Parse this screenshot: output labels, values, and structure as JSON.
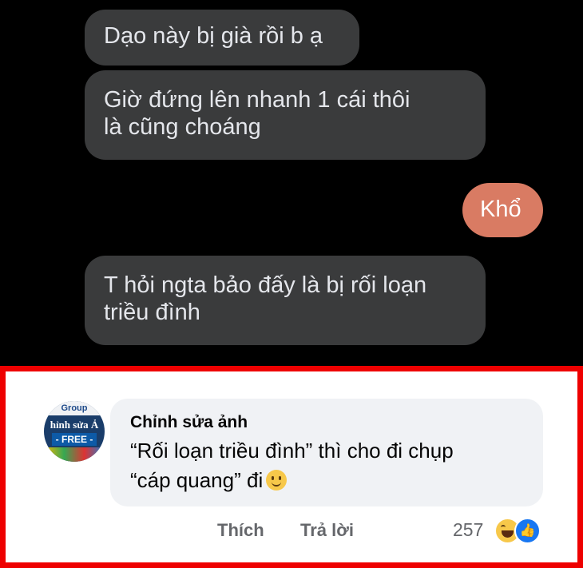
{
  "messages": [
    {
      "text": "Dạo này bị già rồi b ạ",
      "side": "received"
    },
    {
      "line1": "Giờ đứng lên nhanh 1 cái thôi",
      "line2": "là cũng choáng",
      "side": "received"
    },
    {
      "text": "Khổ",
      "side": "sent"
    },
    {
      "line1": "T hỏi ngta bảo đấy là bị rối loạn",
      "line2": "triều đình",
      "side": "received"
    }
  ],
  "comment": {
    "author": "Chỉnh sửa ảnh",
    "line1": "“Rối loạn triều đình” thì cho đi chụp",
    "line2": "“cáp quang” đi",
    "avatar": {
      "group": "Group",
      "name": "hỉnh sửa Ả",
      "free": "- FREE -"
    },
    "actions": {
      "like": "Thích",
      "reply": "Trả lời"
    },
    "reaction_count": "257",
    "reaction_icons": [
      "haha-icon",
      "like-icon"
    ]
  },
  "colors": {
    "highlight_border": "#ee0000",
    "sent_bubble": "#d97b63",
    "received_bubble": "#3a3b3c"
  }
}
